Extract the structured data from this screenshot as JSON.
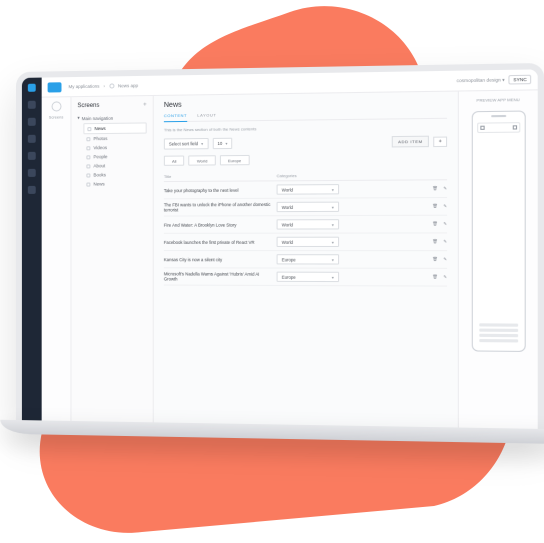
{
  "topbar": {
    "breadcrumb1": "My applications",
    "breadcrumb2": "News app",
    "theme_label": "cosmopolitan design",
    "sync_label": "SYNC"
  },
  "sidecol": {
    "label": "Screens"
  },
  "screens": {
    "title": "Screens",
    "group": "Main navigation",
    "items": [
      {
        "label": "News",
        "active": true
      },
      {
        "label": "Photos"
      },
      {
        "label": "Videos"
      },
      {
        "label": "People"
      },
      {
        "label": "About"
      },
      {
        "label": "Books"
      },
      {
        "label": "News"
      }
    ]
  },
  "main": {
    "title": "News",
    "tabs": {
      "content": "CONTENT",
      "layout": "LAYOUT"
    },
    "hint": "This is the News section of both the News contents",
    "sort_label": "Select sort field",
    "count": "10",
    "add_label": "ADD ITEM",
    "filters": [
      "All",
      "World",
      "Europe"
    ],
    "columns": {
      "title": "Title",
      "category": "Categories"
    },
    "rows": [
      {
        "title": "Take your photography to the next level",
        "category": "World"
      },
      {
        "title": "The FBI wants to unlock the iPhone of another domestic terrorist",
        "category": "World"
      },
      {
        "title": "Fire And Water: A Brooklyn Love Story",
        "category": "World"
      },
      {
        "title": "Facebook launches the first private of React VR",
        "category": "World"
      },
      {
        "title": "Kansas City is now a silent city",
        "category": "Europe"
      },
      {
        "title": "Microsoft's Nadella Warns Against 'Hubris' Amid AI Growth",
        "category": "Europe"
      }
    ]
  },
  "preview": {
    "label": "PREVIEW APP MENU"
  }
}
